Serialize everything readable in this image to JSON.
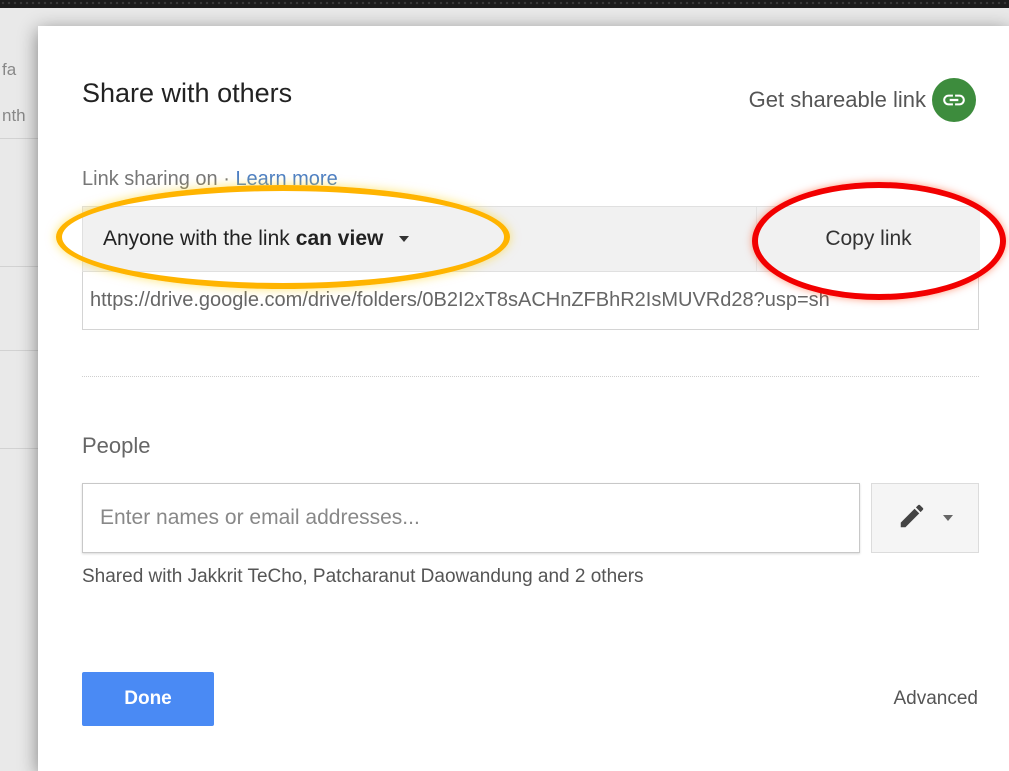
{
  "background": {
    "fragments": [
      "fa",
      "nth"
    ]
  },
  "dialog": {
    "title": "Share with others",
    "get_link_label": "Get shareable link",
    "link_sharing": {
      "status_text": "Link sharing on",
      "learn_more": "Learn more",
      "access_prefix": "Anyone with the link",
      "access_level": "can view",
      "copy_button": "Copy link",
      "url": "https://drive.google.com/drive/folders/0B2I2xT8sACHnZFBhR2IsMUVRd28?usp=sh"
    },
    "people": {
      "label": "People",
      "placeholder": "Enter names or email addresses...",
      "shared_with": "Shared with Jakkrit TeCho, Patcharanut Daowandung and 2 others"
    },
    "done_button": "Done",
    "advanced_link": "Advanced"
  },
  "colors": {
    "accent_blue": "#4a8af4",
    "link_green": "#3d8c3d",
    "highlight_yellow": "#ffb400",
    "highlight_red": "#f20000"
  },
  "icons": {
    "get_link": "link-icon",
    "permission": "pencil-icon",
    "dropdown": "caret-down-icon"
  }
}
